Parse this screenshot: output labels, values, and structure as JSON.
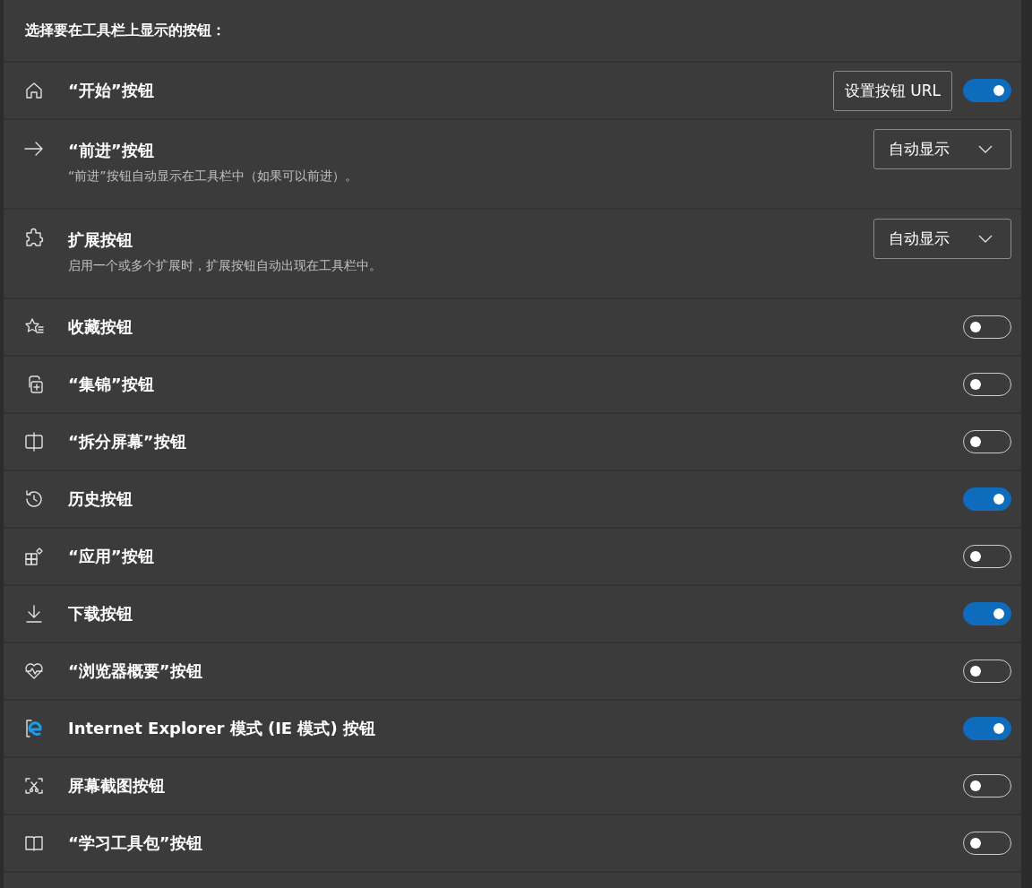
{
  "heading": "选择要在工具栏上显示的按钮：",
  "rows": [
    {
      "kind": "toggle",
      "label": "“开始”按钮",
      "button": "设置按钮 URL",
      "on": true
    },
    {
      "kind": "dropdown",
      "label": "“前进”按钮",
      "description": "“前进”按钮自动显示在工具栏中（如果可以前进）。",
      "value": "自动显示"
    },
    {
      "kind": "dropdown",
      "label": "扩展按钮",
      "description": "启用一个或多个扩展时，扩展按钮自动出现在工具栏中。",
      "value": "自动显示"
    },
    {
      "kind": "toggle",
      "label": "收藏按钮",
      "on": false
    },
    {
      "kind": "toggle",
      "label": "“集锦”按钮",
      "on": false
    },
    {
      "kind": "toggle",
      "label": "“拆分屏幕”按钮",
      "on": false
    },
    {
      "kind": "toggle",
      "label": "历史按钮",
      "on": true
    },
    {
      "kind": "toggle",
      "label": "“应用”按钮",
      "on": false
    },
    {
      "kind": "toggle",
      "label": "下载按钮",
      "on": true
    },
    {
      "kind": "toggle",
      "label": "“浏览器概要”按钮",
      "on": false
    },
    {
      "kind": "toggle",
      "label": "Internet Explorer 模式 (IE 模式) 按钮",
      "on": true
    },
    {
      "kind": "toggle",
      "label": "屏幕截图按钮",
      "on": false
    },
    {
      "kind": "toggle",
      "label": "“学习工具包”按钮",
      "on": false
    }
  ]
}
